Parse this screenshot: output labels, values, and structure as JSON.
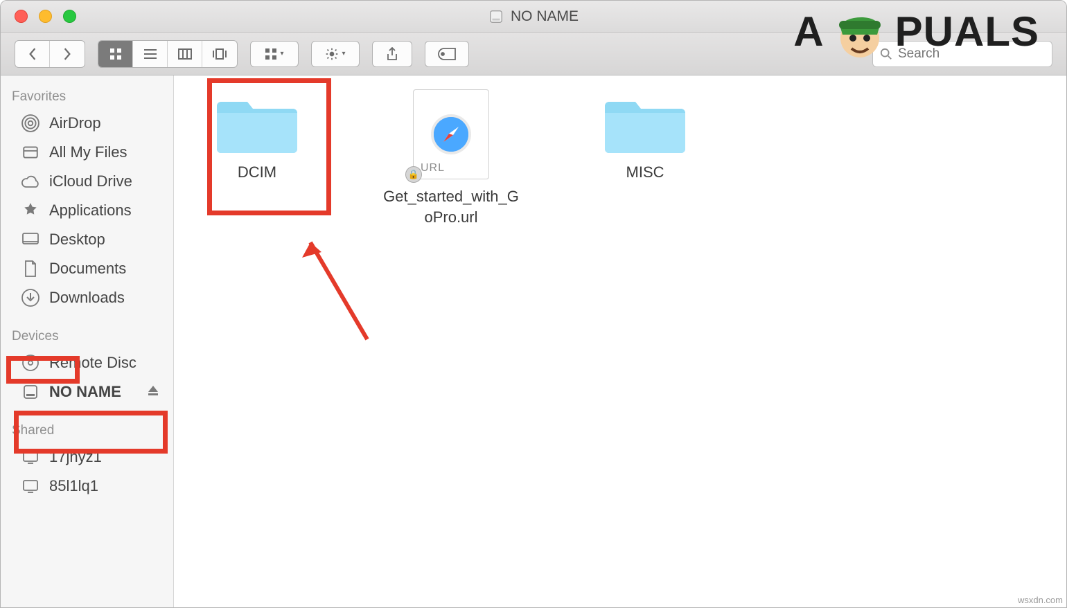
{
  "window": {
    "title": "NO NAME"
  },
  "search": {
    "placeholder": "Search"
  },
  "sidebar": {
    "favorites_header": "Favorites",
    "devices_header": "Devices",
    "shared_header": "Shared",
    "favorites": [
      {
        "label": "AirDrop"
      },
      {
        "label": "All My Files"
      },
      {
        "label": "iCloud Drive"
      },
      {
        "label": "Applications"
      },
      {
        "label": "Desktop"
      },
      {
        "label": "Documents"
      },
      {
        "label": "Downloads"
      }
    ],
    "devices": [
      {
        "label": "Remote Disc"
      },
      {
        "label": "NO NAME"
      }
    ],
    "shared": [
      {
        "label": "17jnyz1"
      },
      {
        "label": "85l1lq1"
      }
    ]
  },
  "files": [
    {
      "name": "DCIM",
      "type": "folder"
    },
    {
      "name": "Get_started_with_GoPro.url",
      "type": "url"
    },
    {
      "name": "MISC",
      "type": "folder"
    }
  ],
  "url_badge_text": "URL",
  "watermark_text_a": "A",
  "watermark_text_b": "PUALS",
  "footer_text": "wsxdn.com"
}
